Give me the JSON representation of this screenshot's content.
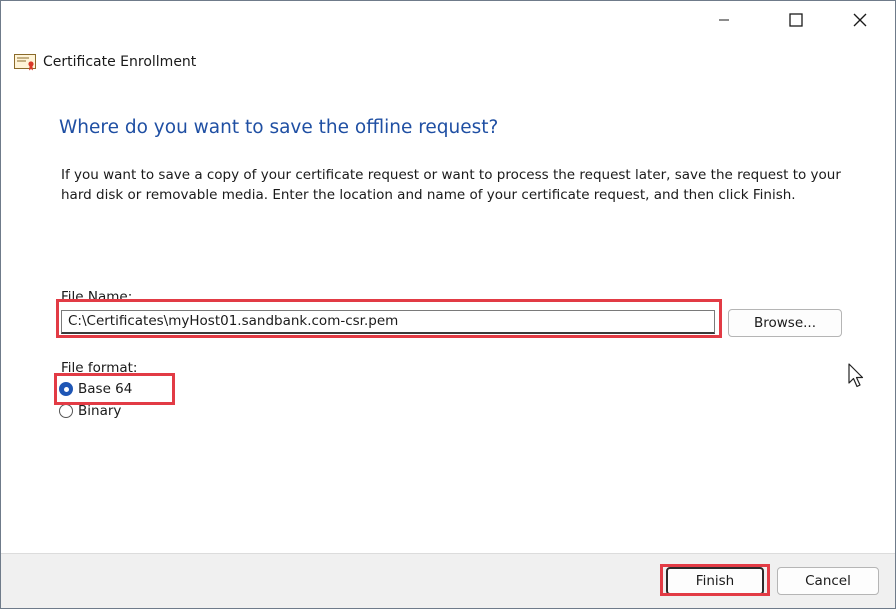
{
  "window": {
    "title": "Certificate Enrollment",
    "controls": {
      "minimize": "minimize-icon",
      "maximize": "maximize-icon",
      "close": "close-icon"
    }
  },
  "page": {
    "heading": "Where do you want to save the offline request?",
    "description": "If you want to save a copy of your certificate request or want to process the request later, save the request to your hard disk or removable media. Enter the location and name of your certificate request, and then click Finish."
  },
  "file": {
    "label": "File Name:",
    "value": "C:\\Certificates\\myHost01.sandbank.com-csr.pem",
    "browse_label": "Browse..."
  },
  "format": {
    "label": "File format:",
    "options": [
      {
        "label": "Base 64",
        "selected": true
      },
      {
        "label": "Binary",
        "selected": false
      }
    ]
  },
  "footer": {
    "finish_label": "Finish",
    "cancel_label": "Cancel"
  },
  "colors": {
    "heading": "#1f4fa3",
    "highlight": "#e23b45",
    "radio_selected": "#1f56b5"
  }
}
